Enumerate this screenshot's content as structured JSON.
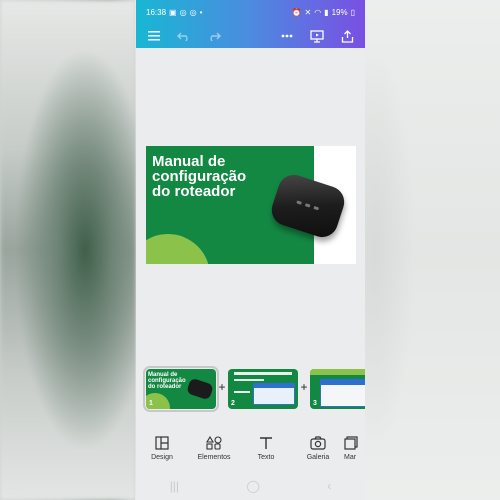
{
  "status_bar": {
    "time": "16:38",
    "battery": "19%"
  },
  "slide": {
    "title": "Manual de\nconfiguração\ndo roteador"
  },
  "thumbnails": [
    {
      "number": "1",
      "title": "Manual de\nconfiguração\ndo roteador"
    },
    {
      "number": "2"
    },
    {
      "number": "3"
    }
  ],
  "bottom_nav": [
    {
      "label": "Design",
      "icon": "layout-icon"
    },
    {
      "label": "Elementos",
      "icon": "shapes-icon"
    },
    {
      "label": "Texto",
      "icon": "text-icon"
    },
    {
      "label": "Galeria",
      "icon": "camera-icon"
    },
    {
      "label": "Mar",
      "icon": "brand-icon"
    }
  ],
  "colors": {
    "toolbar_gradient_start": "#18b7d3",
    "toolbar_gradient_end": "#7a4fe3",
    "slide_green": "#138843",
    "slide_lime": "#8bc34a"
  }
}
